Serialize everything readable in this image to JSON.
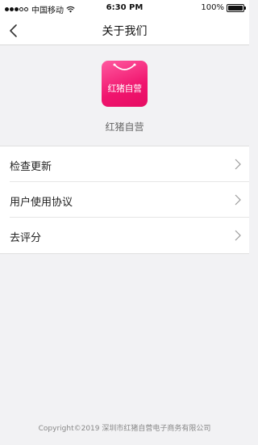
{
  "status_bar": {
    "carrier": "中国移动",
    "time": "6:30 PM",
    "battery": "100%"
  },
  "nav": {
    "title": "关于我们"
  },
  "app": {
    "logo_text": "红猪自营",
    "name": "红猪自营",
    "logo_color": "#f0156e"
  },
  "menu": {
    "items": [
      {
        "label": "检查更新",
        "icon": "chevron-right-icon"
      },
      {
        "label": "用户使用协议",
        "icon": "chevron-right-icon"
      },
      {
        "label": "去评分",
        "icon": "chevron-right-icon"
      }
    ]
  },
  "footer": {
    "copyright": "Copyright©2019   深圳市红猪自营电子商务有限公司"
  }
}
